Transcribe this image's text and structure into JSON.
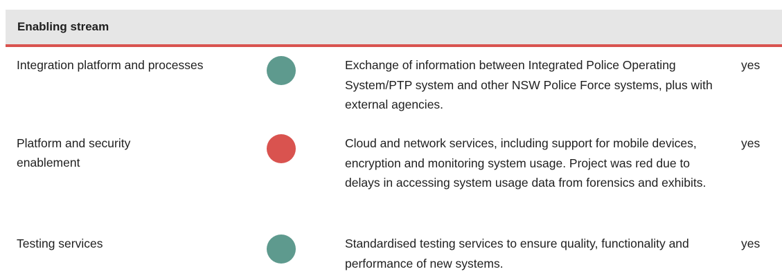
{
  "section": {
    "title": "Enabling stream",
    "accent_color": "#d9534f"
  },
  "status_colors": {
    "green": "#5e9a8e",
    "red": "#d9534f"
  },
  "rows": [
    {
      "name": "Integration platform and processes",
      "status": "green",
      "description": "Exchange of information between Integrated Police Operating System/PTP system and other NSW Police Force systems, plus with external agencies.",
      "flag": "yes"
    },
    {
      "name": "Platform and security enablement",
      "status": "red",
      "description": "Cloud and network services, including support for mobile devices, encryption and monitoring system usage. Project was red due to delays in accessing system usage data from forensics and exhibits.",
      "flag": "yes"
    },
    {
      "name": "Testing services",
      "status": "green",
      "description": "Standardised testing services to ensure quality, functionality and performance of new systems.",
      "flag": "yes"
    }
  ]
}
